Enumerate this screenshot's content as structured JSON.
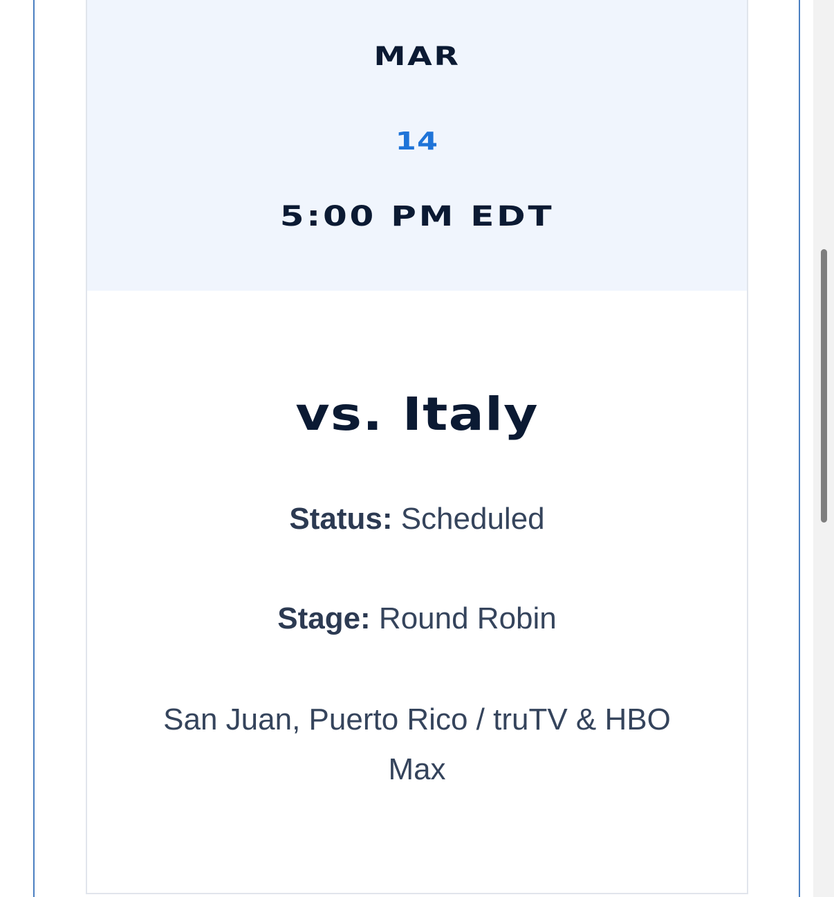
{
  "event": {
    "month": "MAR",
    "day": "14",
    "time": "5:00 PM EDT",
    "opponent": "vs. Italy",
    "status_label": "Status:",
    "status_value": " Scheduled",
    "stage_label": "Stage:",
    "stage_value": " Round Robin",
    "location_broadcast": "San Juan, Puerto Rico / truTV & HBO Max"
  },
  "colors": {
    "header_bg": "#f0f5fd",
    "day_accent": "#1f74d8",
    "navy_text": "#0b1a33",
    "body_text": "#35445c",
    "frame_blue": "#4a7fc1"
  }
}
